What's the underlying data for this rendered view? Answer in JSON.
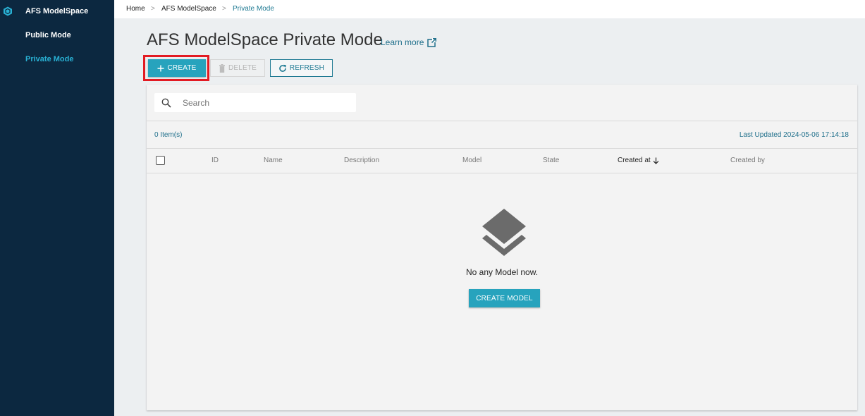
{
  "sidebar": {
    "brand": "AFS ModelSpace",
    "items": [
      {
        "label": "Public Mode",
        "active": false
      },
      {
        "label": "Private Mode",
        "active": true
      }
    ]
  },
  "breadcrumb": [
    "Home",
    "AFS ModelSpace",
    "Private Mode"
  ],
  "breadcrumb_separator": ">",
  "page": {
    "title": "AFS ModelSpace Private Mode",
    "learn_more": "Learn more"
  },
  "toolbar": {
    "create_label": "CREATE",
    "delete_label": "DELETE",
    "refresh_label": "REFRESH"
  },
  "search": {
    "placeholder": "Search",
    "value": ""
  },
  "list": {
    "item_count": "0 Item(s)",
    "last_updated": "Last Updated 2024-05-06 17:14:18",
    "columns": [
      "ID",
      "Name",
      "Description",
      "Model",
      "State",
      "Created at",
      "Created by"
    ],
    "sorted_column": "Created at",
    "rows": []
  },
  "empty_state": {
    "message": "No any Model now.",
    "button_label": "CREATE MODEL"
  },
  "icons": {
    "brand": "hexagon-logo-icon",
    "create": "plus-icon",
    "delete": "trash-icon",
    "refresh": "refresh-icon",
    "learn_more": "external-link-icon",
    "search": "search-icon",
    "sort": "arrow-down-icon",
    "empty": "layers-icon"
  },
  "colors": {
    "sidebar_bg": "#0c2840",
    "accent": "#27a3bd",
    "link": "#1f6f8b",
    "active_nav": "#29b1d4",
    "highlight": "#e31b23"
  }
}
